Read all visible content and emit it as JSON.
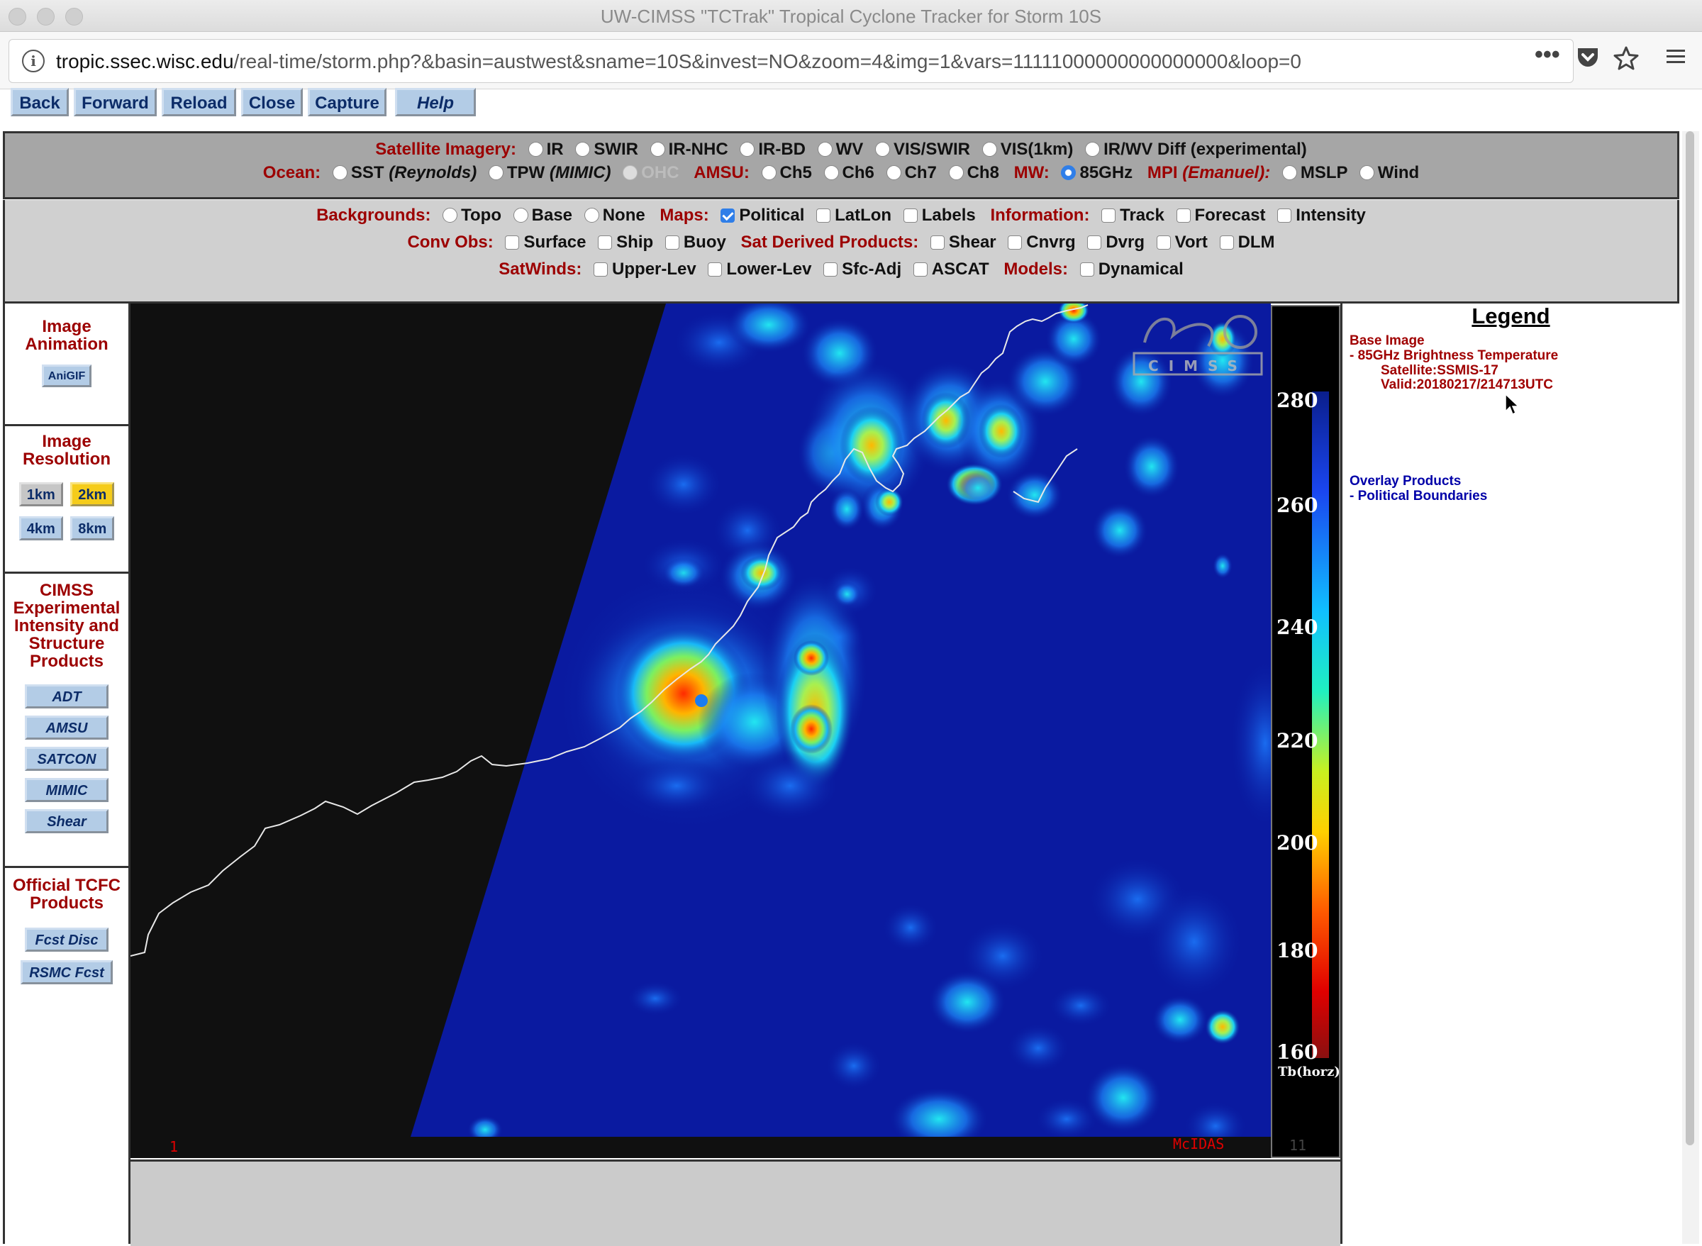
{
  "window": {
    "title": "UW-CIMSS \"TCTrak\" Tropical Cyclone Tracker for Storm 10S"
  },
  "browser": {
    "url_domain": "tropic.ssec.wisc.edu",
    "url_path": "/real-time/storm.php?&basin=austwest&sname=10S&invest=NO&zoom=4&img=1&vars=11111000000000000000&loop=0",
    "icons": [
      "info-icon",
      "more-icon",
      "pocket-icon",
      "bookmark-star-icon",
      "menu-icon"
    ]
  },
  "toolbar": {
    "back": "Back",
    "forward": "Forward",
    "reload": "Reload",
    "close": "Close",
    "capture": "Capture",
    "help": "Help"
  },
  "satellite": {
    "label": "Satellite Imagery:",
    "options": [
      "IR",
      "SWIR",
      "IR-NHC",
      "IR-BD",
      "WV",
      "VIS/SWIR",
      "VIS(1km)",
      "IR/WV Diff (experimental)"
    ]
  },
  "ocean": {
    "label": "Ocean:",
    "sst": "SST",
    "sst_src": "(Reynolds)",
    "tpw": "TPW",
    "tpw_src": "(MIMIC)",
    "ohc": "OHC"
  },
  "amsu": {
    "label": "AMSU:",
    "options": [
      "Ch5",
      "Ch6",
      "Ch7",
      "Ch8"
    ]
  },
  "mw": {
    "label": "MW:",
    "option": "85GHz",
    "selected": true
  },
  "mpi": {
    "label": "MPI",
    "src": "(Emanuel):",
    "options": [
      "MSLP",
      "Wind"
    ]
  },
  "backgrounds": {
    "label": "Backgrounds:",
    "options": [
      "Topo",
      "Base",
      "None"
    ]
  },
  "maps": {
    "label": "Maps:",
    "options": [
      "Political",
      "LatLon",
      "Labels"
    ],
    "checked": [
      "Political"
    ]
  },
  "information": {
    "label": "Information:",
    "options": [
      "Track",
      "Forecast",
      "Intensity"
    ]
  },
  "conv_obs": {
    "label": "Conv Obs:",
    "options": [
      "Surface",
      "Ship",
      "Buoy"
    ]
  },
  "sat_derived": {
    "label": "Sat Derived Products:",
    "options": [
      "Shear",
      "Cnvrg",
      "Dvrg",
      "Vort",
      "DLM"
    ]
  },
  "satwinds": {
    "label": "SatWinds:",
    "options": [
      "Upper-Lev",
      "Lower-Lev",
      "Sfc-Adj",
      "ASCAT"
    ]
  },
  "models": {
    "label": "Models:",
    "options": [
      "Dynamical"
    ]
  },
  "sidebar": {
    "animation_title": "Image Animation",
    "anigif": "AniGIF",
    "resolution_title": "Image Resolution",
    "res_options": [
      "1km",
      "2km",
      "4km",
      "8km"
    ],
    "res_selected": "2km",
    "cimss_title": "CIMSS Experimental Intensity and Structure Products",
    "cimss_buttons": [
      "ADT",
      "AMSU",
      "SATCON",
      "MIMIC",
      "Shear"
    ],
    "official_title": "Official TCFC Products",
    "official_buttons": [
      "Fcst Disc",
      "RSMC Fcst"
    ]
  },
  "image": {
    "frame_number": "1",
    "mcidas_label": "McIDAS",
    "logo_text": "CIMSS",
    "colorbar_ticks": [
      "280",
      "260",
      "240",
      "220",
      "200",
      "180",
      "160"
    ],
    "colorbar_unit": "Tb(horz)",
    "colorbar_corner": "11"
  },
  "legend": {
    "title": "Legend",
    "base_image": "Base Image",
    "base_product": "-  85GHz Brightness Temperature",
    "satellite": "Satellite:SSMIS-17",
    "valid": "Valid:20180217/214713UTC",
    "overlay": "Overlay Products",
    "overlay_item": "-  Political Boundaries"
  },
  "colors": {
    "button_bg": "#b3cce6",
    "label_red": "#9c0000",
    "selected_res": "#f5cc1a",
    "ocean_blue": "#0a1aa0"
  }
}
